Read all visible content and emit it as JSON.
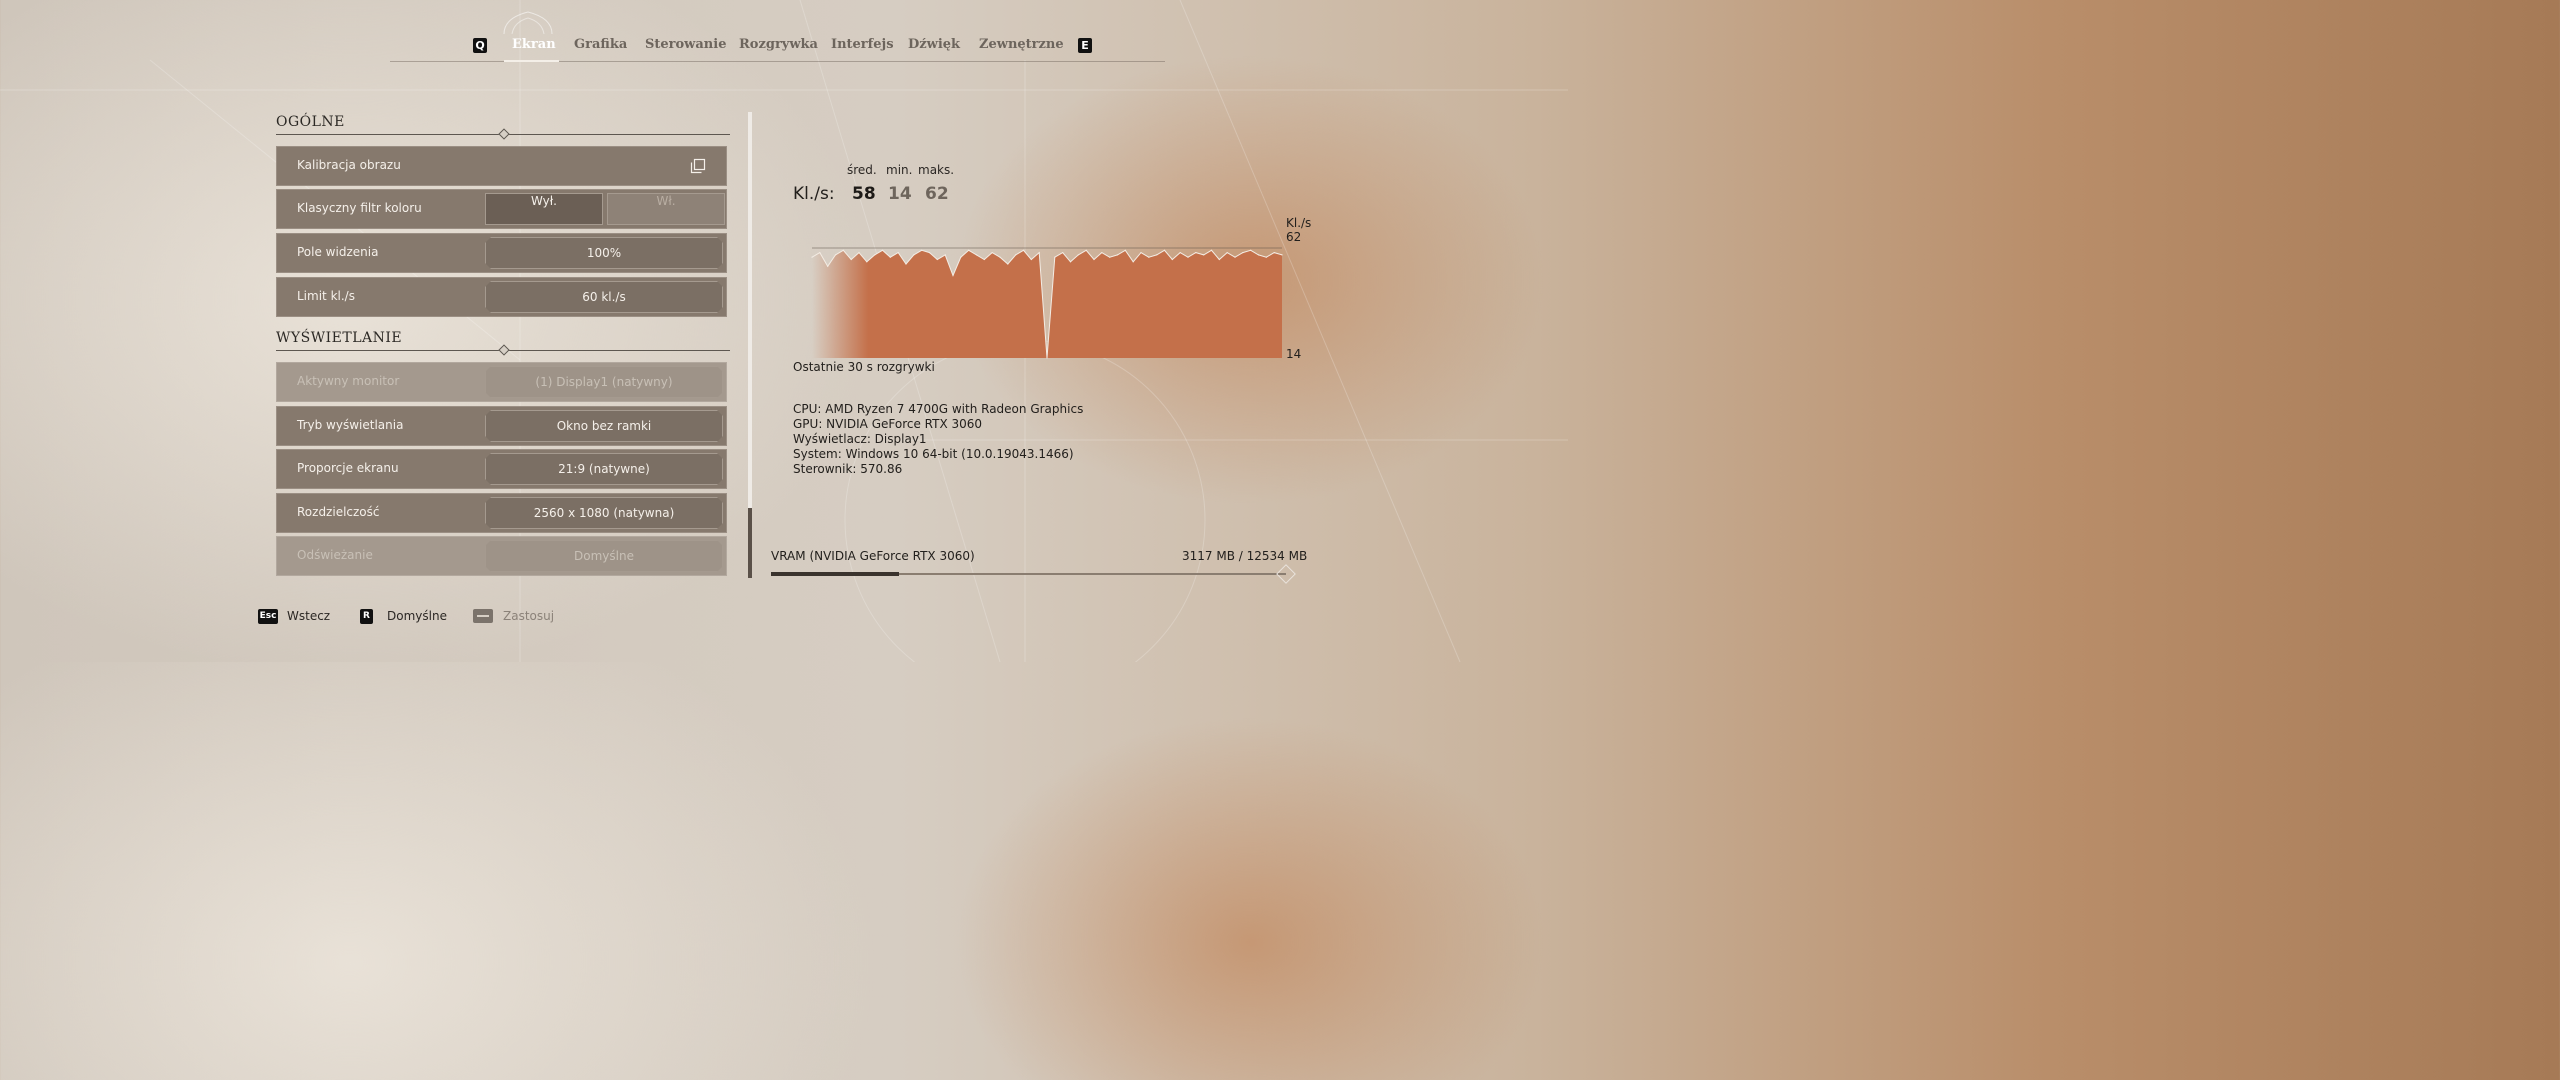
{
  "nav": {
    "left_key": "Q",
    "right_key": "E",
    "tabs": [
      "Ekran",
      "Grafika",
      "Sterowanie",
      "Rozgrywka",
      "Interfejs",
      "Dźwięk",
      "Zewnętrzne"
    ],
    "active_tab": "Ekran"
  },
  "sections": {
    "general": "OGÓLNE",
    "display": "WYŚWIETLANIE"
  },
  "settings": {
    "calibration": {
      "label": "Kalibracja obrazu",
      "icon": "copy-icon"
    },
    "color_filter": {
      "label": "Klasyczny filtr koloru",
      "option_off": "Wył.",
      "option_on": "Wł.",
      "selected": "Wył."
    },
    "fov": {
      "label": "Pole widzenia",
      "value": "100%"
    },
    "fps_limit": {
      "label": "Limit kl./s",
      "value": "60 kl./s"
    },
    "monitor": {
      "label": "Aktywny monitor",
      "value": "(1) Display1 (natywny)",
      "disabled": true
    },
    "display_mode": {
      "label": "Tryb wyświetlania",
      "value": "Okno bez ramki"
    },
    "aspect": {
      "label": "Proporcje ekranu",
      "value": "21:9 (natywne)"
    },
    "resolution": {
      "label": "Rozdzielczość",
      "value": "2560 x 1080 (natywna)"
    },
    "refresh": {
      "label": "Odświeżanie",
      "value": "Domyślne",
      "disabled": true
    }
  },
  "hints": {
    "back_key": "Esc",
    "back": "Wstecz",
    "default_key": "R",
    "default": "Domyślne",
    "apply": "Zastosuj",
    "apply_disabled": true
  },
  "stats": {
    "avg_label": "śred.",
    "min_label": "min.",
    "max_label": "maks.",
    "fps_label": "Kl./s:",
    "avg": "58",
    "min": "14",
    "max": "62",
    "chart_unit": "Kl./s",
    "chart_max_label": "62",
    "chart_min_label": "14",
    "caption": "Ostatnie 30 s rozgrywki"
  },
  "chart_data": {
    "type": "area",
    "title": "",
    "xlabel": "Ostatnie 30 s rozgrywki",
    "ylabel": "Kl./s",
    "ylim": [
      14,
      62
    ],
    "y_ticks": [
      62,
      14
    ],
    "xlim": [
      0,
      30
    ],
    "series": [
      {
        "color": "#c4704a",
        "x": [
          0,
          0.5,
          1,
          1.5,
          2,
          2.5,
          3,
          3.5,
          4,
          4.5,
          5,
          5.5,
          6,
          6.5,
          7,
          7.5,
          8,
          8.5,
          9,
          9.5,
          10,
          10.5,
          11,
          11.5,
          12,
          12.5,
          13,
          13.5,
          14,
          14.5,
          15,
          15.5,
          16,
          16.5,
          17,
          17.5,
          18,
          18.5,
          19,
          19.5,
          20,
          20.5,
          21,
          21.5,
          22,
          22.5,
          23,
          23.5,
          24,
          24.5,
          25,
          25.5,
          26,
          26.5,
          27,
          27.5,
          28,
          28.5,
          29,
          29.5,
          30
        ],
        "values": [
          58,
          60,
          54,
          59,
          61,
          57,
          60,
          56,
          59,
          61,
          58,
          60,
          55,
          59,
          61,
          60,
          57,
          59,
          50,
          58,
          61,
          59,
          57,
          60,
          58,
          55,
          59,
          61,
          57,
          60,
          14,
          58,
          60,
          56,
          59,
          61,
          57,
          60,
          58,
          59,
          61,
          56,
          60,
          58,
          59,
          61,
          57,
          60,
          58,
          60,
          59,
          61,
          57,
          60,
          58,
          60,
          61,
          59,
          58,
          60,
          59
        ]
      }
    ]
  },
  "system": {
    "cpu": "CPU: AMD Ryzen 7 4700G with Radeon Graphics",
    "gpu": "GPU: NVIDIA GeForce RTX 3060",
    "display": "Wyświetlacz: Display1",
    "os": "System: Windows 10  64-bit (10.0.19043.1466)",
    "driver": "Sterownik: 570.86"
  },
  "vram": {
    "label": "VRAM (NVIDIA GeForce RTX 3060)",
    "value": "3117 MB / 12534 MB",
    "used_mb": 3117,
    "total_mb": 12534
  }
}
